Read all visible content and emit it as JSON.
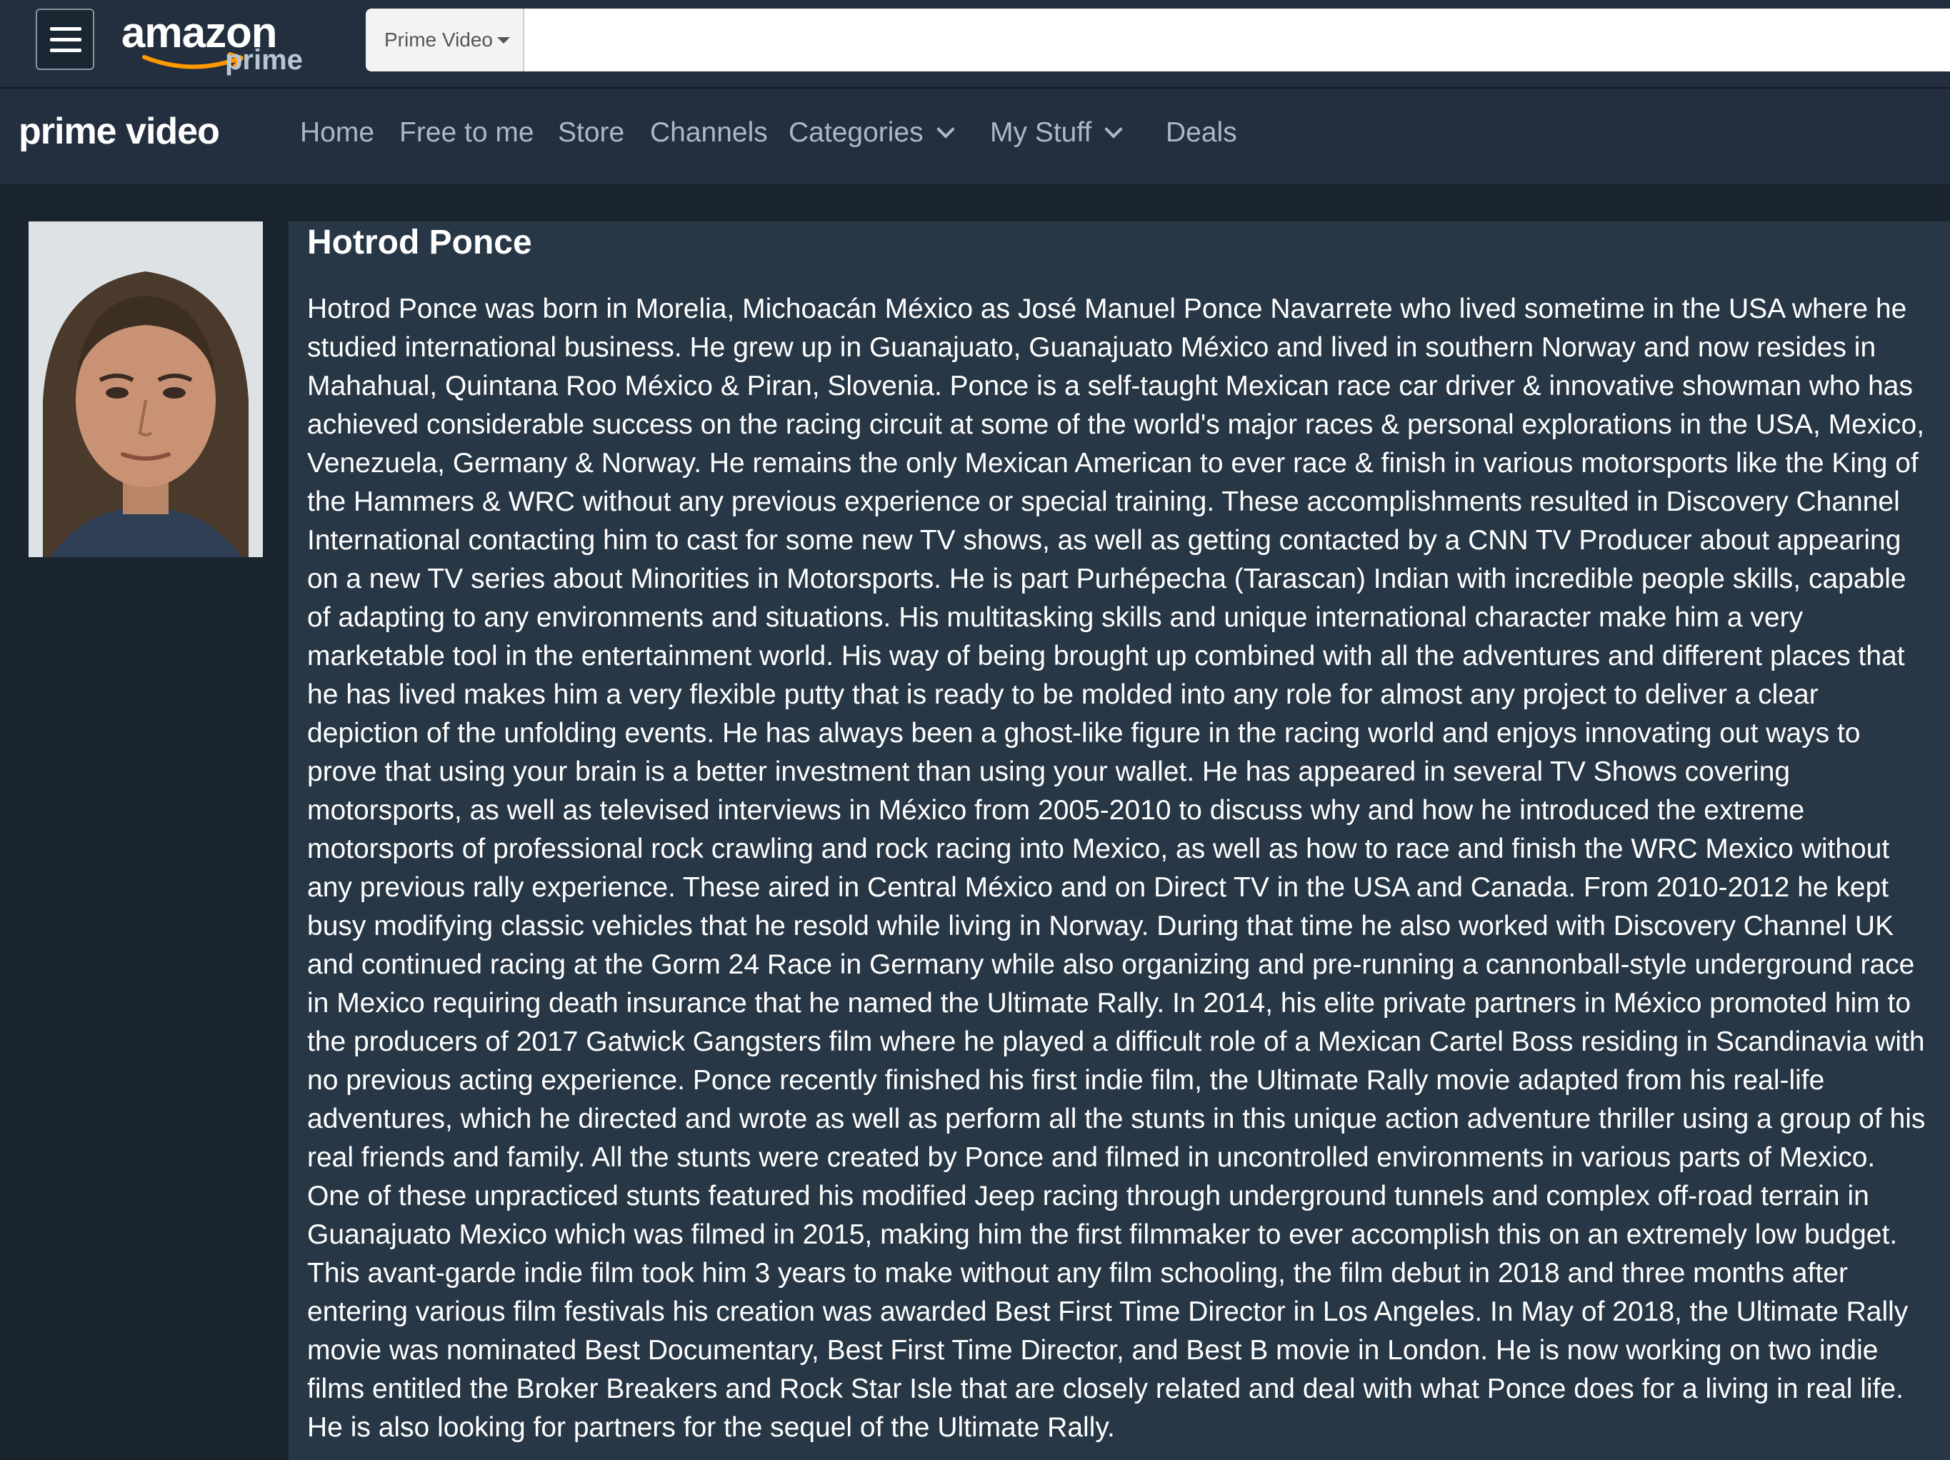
{
  "header": {
    "logo_text": "amazon",
    "logo_sub": "prime",
    "search": {
      "department": "Prime Video",
      "value": ""
    }
  },
  "nav": {
    "brand": "prime video",
    "items": [
      {
        "label": "Home"
      },
      {
        "label": "Free to me"
      },
      {
        "label": "Store"
      },
      {
        "label": "Channels"
      },
      {
        "label": "Categories",
        "has_dropdown": true
      },
      {
        "label": "My Stuff",
        "has_dropdown": true
      },
      {
        "label": "Deals"
      }
    ]
  },
  "profile": {
    "name": "Hotrod Ponce",
    "bio": "Hotrod Ponce was born in Morelia, Michoacán México as José Manuel Ponce Navarrete who lived sometime in the USA where he studied international business. He grew up in Guanajuato, Guanajuato México and lived in southern Norway and now resides in Mahahual, Quintana Roo México & Piran, Slovenia. Ponce is a self-taught Mexican race car driver & innovative showman who has achieved considerable success on the racing circuit at some of the world's major races & personal explorations in the USA, Mexico, Venezuela, Germany & Norway. He remains the only Mexican American to ever race & finish in various motorsports like the King of the Hammers & WRC without any previous experience or special training. These accomplishments resulted in Discovery Channel International contacting him to cast for some new TV shows, as well as getting contacted by a CNN TV Producer about appearing on a new TV series about Minorities in Motorsports. He is part Purhépecha (Tarascan) Indian with incredible people skills, capable of adapting to any environments and situations. His multitasking skills and unique international character make him a very marketable tool in the entertainment world. His way of being brought up combined with all the adventures and different places that he has lived makes him a very flexible putty that is ready to be molded into any role for almost any project to deliver a clear depiction of the unfolding events. He has always been a ghost-like figure in the racing world and enjoys innovating out ways to prove that using your brain is a better investment than using your wallet. He has appeared in several TV Shows covering motorsports, as well as televised interviews in México from 2005-2010 to discuss why and how he introduced the extreme motorsports of professional rock crawling and rock racing into Mexico, as well as how to race and finish the WRC Mexico without any previous rally experience. These aired in Central México and on Direct TV in the USA and Canada. From 2010-2012 he kept busy modifying classic vehicles that he resold while living in Norway. During that time he also worked with Discovery Channel UK and continued racing at the Gorm 24 Race in Germany while also organizing and pre-running a cannonball-style underground race in Mexico requiring death insurance that he named the Ultimate Rally. In 2014, his elite private partners in México promoted him to the producers of 2017 Gatwick Gangsters film where he played a difficult role of a Mexican Cartel Boss residing in Scandinavia with no previous acting experience. Ponce recently finished his first indie film, the Ultimate Rally movie adapted from his real-life adventures, which he directed and wrote as well as perform all the stunts in this unique action adventure thriller using a group of his real friends and family. All the stunts were created by Ponce and filmed in uncontrolled environments in various parts of Mexico. One of these unpracticed stunts featured his modified Jeep racing through underground tunnels and complex off-road terrain in Guanajuato Mexico which was filmed in 2015, making him the first filmmaker to ever accomplish this on an extremely low budget. This avant-garde indie film took him 3 years to make without any film schooling, the film debut in 2018 and three months after entering various film festivals his creation was awarded Best First Time Director in Los Angeles. In May of 2018, the Ultimate Rally movie was nominated Best Documentary, Best First Time Director, and Best B movie in London. He is now working on two indie films entitled the Broker Breakers and Rock Star Isle that are closely related and deal with what Ponce does for a living in real life. He is also looking for partners for the sequel of the Ultimate Rally."
  },
  "colors": {
    "topbar_bg": "#232f3e",
    "page_bg": "#1a242f",
    "panel_bg": "#283746",
    "nav_text": "#aab7c4",
    "amazon_smile": "#ff9900"
  }
}
